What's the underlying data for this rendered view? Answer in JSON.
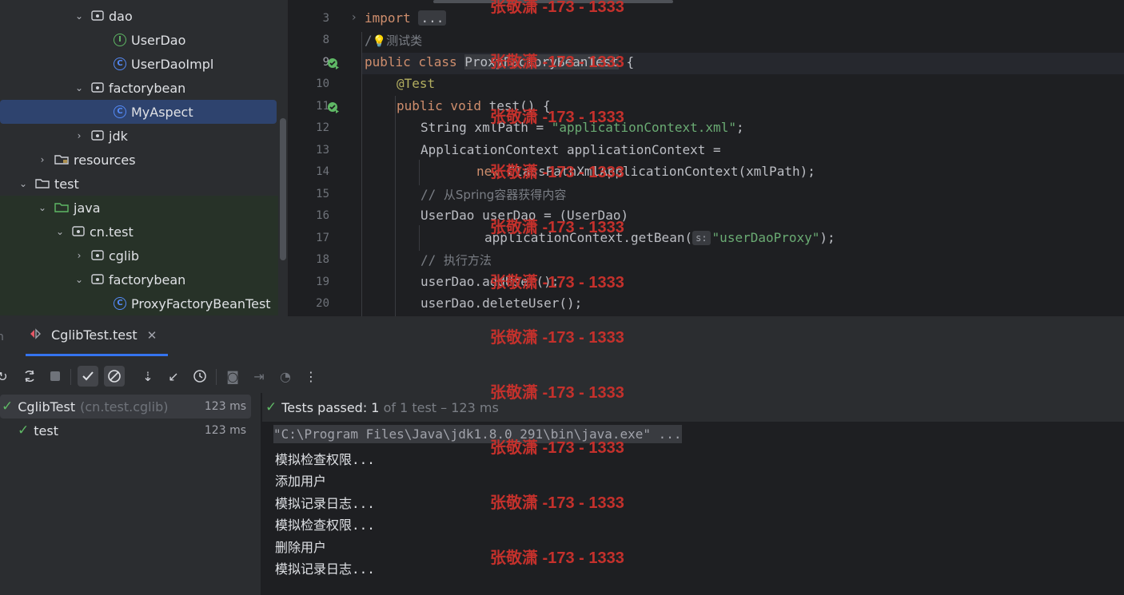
{
  "tree": {
    "items": [
      {
        "label": "dao",
        "kind": "package",
        "depth": 4,
        "expanded": true
      },
      {
        "label": "UserDao",
        "kind": "interface",
        "depth": 6
      },
      {
        "label": "UserDaoImpl",
        "kind": "class",
        "depth": 6
      },
      {
        "label": "factorybean",
        "kind": "package",
        "depth": 4,
        "expanded": true
      },
      {
        "label": "MyAspect",
        "kind": "class",
        "depth": 6,
        "selected": true
      },
      {
        "label": "jdk",
        "kind": "package",
        "depth": 4,
        "expanded": false
      },
      {
        "label": "resources",
        "kind": "folder",
        "depth": 2,
        "expanded": false
      },
      {
        "label": "test",
        "kind": "folder",
        "depth": 1,
        "expanded": true
      },
      {
        "label": "java",
        "kind": "testfolder",
        "depth": 2,
        "expanded": true
      },
      {
        "label": "cn.test",
        "kind": "package",
        "depth": 3,
        "expanded": true
      },
      {
        "label": "cglib",
        "kind": "package",
        "depth": 4,
        "expanded": false
      },
      {
        "label": "factorybean",
        "kind": "package",
        "depth": 4,
        "expanded": true
      },
      {
        "label": "ProxyFactoryBeanTest",
        "kind": "class",
        "depth": 6
      }
    ]
  },
  "editor": {
    "line_numbers": [
      "3",
      "8",
      "9",
      "10",
      "11",
      "12",
      "13",
      "14",
      "15",
      "16",
      "17",
      "18",
      "19",
      "20"
    ],
    "lines": {
      "l3_kw": "import",
      "l3_fold": "...",
      "l8_a": "/",
      "l8_b": "测试类",
      "l9_kw": "public class",
      "l9_name": "ProxyFactoryBeanTest",
      "l9_rest": " {",
      "l10": "@Test",
      "l11_kw": "public void",
      "l11_rest": " test() {",
      "l12_a": "String xmlPath = ",
      "l12_str": "\"applicationContext.xml\"",
      "l12_b": ";",
      "l13": "ApplicationContext applicationContext =",
      "l14_kw": "new",
      "l14_rest": " ClassPathXmlApplicationContext(xmlPath);",
      "l15_a": "// ",
      "l15_b": "从Spring容器获得内容",
      "l16": "UserDao userDao = (UserDao)",
      "l17_a": "applicationContext.getBean(",
      "l17_hint": "s:",
      "l17_str": "\"userDaoProxy\"",
      "l17_b": ");",
      "l18_a": "// ",
      "l18_b": "执行方法",
      "l19": "userDao.addUser();",
      "l20": "userDao.deleteUser();"
    }
  },
  "run": {
    "tab_label": "CglibTest.test",
    "tests": [
      {
        "name": "CglibTest",
        "pkg": "(cn.test.cglib)",
        "time": "123 ms"
      },
      {
        "name": "test",
        "time": "123 ms"
      }
    ],
    "status_prefix": "Tests passed: ",
    "status_count": "1",
    "status_suffix": " of 1 test – 123 ms",
    "console": [
      "\"C:\\Program Files\\Java\\jdk1.8.0_291\\bin\\java.exe\" ...",
      "模拟检查权限...",
      "添加用户",
      "模拟记录日志...",
      "模拟检查权限...",
      "删除用户",
      "模拟记录日志..."
    ]
  },
  "watermark": "张敬潇 -173 - 1333",
  "colors": {
    "accent": "#3574f0",
    "success": "#5fb865",
    "keyword": "#cf8e6d",
    "string": "#6aab73",
    "watermark": "#c4312c"
  }
}
